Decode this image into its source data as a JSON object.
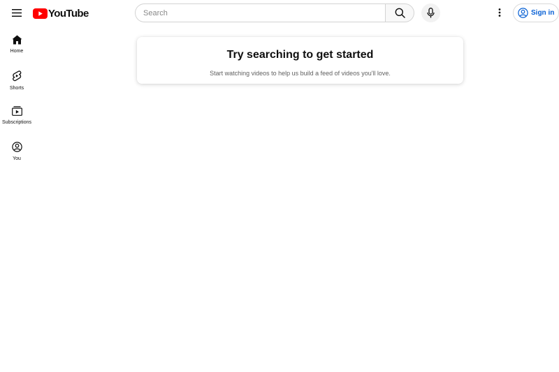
{
  "header": {
    "menu_icon": "hamburger-menu-icon",
    "logo_text": "YouTube",
    "brand_color": "#ff0000",
    "search": {
      "placeholder": "Search",
      "value": ""
    },
    "search_icon": "search-icon",
    "mic_icon": "microphone-icon",
    "more_icon": "more-vert-icon",
    "signin_label": "Sign in",
    "signin_color": "#065fd4"
  },
  "sidebar": {
    "items": [
      {
        "label": "Home",
        "icon": "home-icon"
      },
      {
        "label": "Shorts",
        "icon": "shorts-icon"
      },
      {
        "label": "Subscriptions",
        "icon": "subscriptions-icon"
      },
      {
        "label": "You",
        "icon": "account-icon"
      }
    ]
  },
  "main": {
    "title": "Try searching to get started",
    "subtitle": "Start watching videos to help us build a feed of videos you'll love."
  }
}
